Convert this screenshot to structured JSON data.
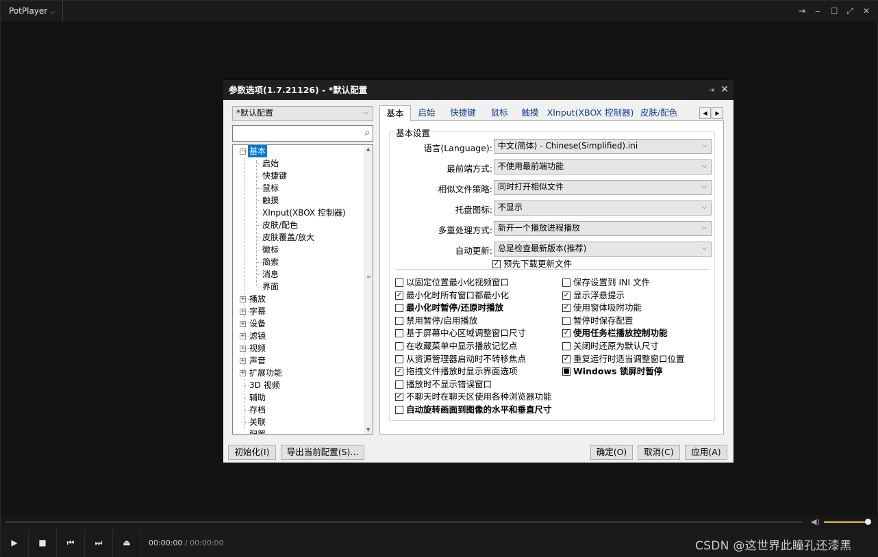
{
  "app": {
    "name": "PotPlayer"
  },
  "playback": {
    "current_time": "00:00:00",
    "separator": "/",
    "total_time": "00:00:00",
    "volume_fraction": 0.93
  },
  "watermark": "CSDN @这世界此瞳孔还漆黑",
  "dialog": {
    "title": "参数选项(1.7.21126) - *默认配置",
    "profile": "*默认配置",
    "search_placeholder": "",
    "tree": [
      {
        "label": "基本",
        "selected": true
      },
      {
        "label": "启始"
      },
      {
        "label": "快捷键"
      },
      {
        "label": "鼠标"
      },
      {
        "label": "触摸"
      },
      {
        "label": "XInput(XBOX 控制器)"
      },
      {
        "label": "皮肤/配色"
      },
      {
        "label": "皮肤覆盖/放大"
      },
      {
        "label": "徽标"
      },
      {
        "label": "简索"
      },
      {
        "label": "消息"
      },
      {
        "label": "界面"
      },
      {
        "label": "播放"
      },
      {
        "label": "字幕"
      },
      {
        "label": "设备"
      },
      {
        "label": "滤镜"
      },
      {
        "label": "视频"
      },
      {
        "label": "声音"
      },
      {
        "label": "扩展功能"
      },
      {
        "label": "3D 视频"
      },
      {
        "label": "辅助"
      },
      {
        "label": "存档"
      },
      {
        "label": "关联"
      },
      {
        "label": "配置"
      }
    ],
    "tabs": [
      "基本",
      "启始",
      "快捷键",
      "鼠标",
      "触摸",
      "XInput(XBOX 控制器)",
      "皮肤/配色"
    ],
    "group_title": "基本设置",
    "fields": [
      {
        "label": "语言(Language):",
        "value": "中文(简体) - Chinese(Simplified).ini"
      },
      {
        "label": "最前端方式:",
        "value": "不使用最前端功能"
      },
      {
        "label": "相似文件策略:",
        "value": "同时打开相似文件"
      },
      {
        "label": "托盘图标:",
        "value": "不显示"
      },
      {
        "label": "多重处理方式:",
        "value": "新开一个播放进程播放"
      },
      {
        "label": "自动更新:",
        "value": "总是检查最新版本(推荐)"
      }
    ],
    "predownload": {
      "label": "预先下载更新文件",
      "checked": true
    },
    "left_checks": [
      {
        "label": "以固定位置最小化视频窗口",
        "checked": false,
        "bold": false
      },
      {
        "label": "最小化时所有窗口都最小化",
        "checked": true,
        "bold": false
      },
      {
        "label": "最小化时暂停/还原时播放",
        "checked": false,
        "bold": true
      },
      {
        "label": "禁用暂停/启用播放",
        "checked": false,
        "bold": false
      },
      {
        "label": "基于屏幕中心区域调整窗口尺寸",
        "checked": false,
        "bold": false
      },
      {
        "label": "在收藏菜单中显示播放记忆点",
        "checked": false,
        "bold": false
      },
      {
        "label": "从资源管理器启动时不转移焦点",
        "checked": false,
        "bold": false
      },
      {
        "label": "拖拽文件播放时显示界面选项",
        "checked": true,
        "bold": false
      },
      {
        "label": "播放时不显示错误窗口",
        "checked": false,
        "bold": false
      },
      {
        "label": "不聊天时在聊天区使用各种浏览器功能",
        "checked": true,
        "bold": false
      },
      {
        "label": "自动旋转画面到图像的水平和垂直尺寸",
        "checked": false,
        "bold": true
      }
    ],
    "right_checks": [
      {
        "label": "保存设置到 INI 文件",
        "checked": false,
        "bold": false
      },
      {
        "label": "显示浮悬提示",
        "checked": true,
        "bold": false
      },
      {
        "label": "使用窗体吸附功能",
        "checked": true,
        "bold": false
      },
      {
        "label": "暂停时保存配置",
        "checked": false,
        "bold": false
      },
      {
        "label": "使用任务栏播放控制功能",
        "checked": true,
        "bold": true
      },
      {
        "label": "关闭时还原为默认尺寸",
        "checked": false,
        "bold": false
      },
      {
        "label": "重复运行时适当调整窗口位置",
        "checked": true,
        "bold": false
      },
      {
        "label": "Windows 锁屏时暂停",
        "checked": "partial",
        "bold": true
      }
    ],
    "buttons": {
      "init": "初始化(I)",
      "export": "导出当前配置(S)...",
      "ok": "确定(O)",
      "cancel": "取消(C)",
      "apply": "应用(A)"
    }
  }
}
